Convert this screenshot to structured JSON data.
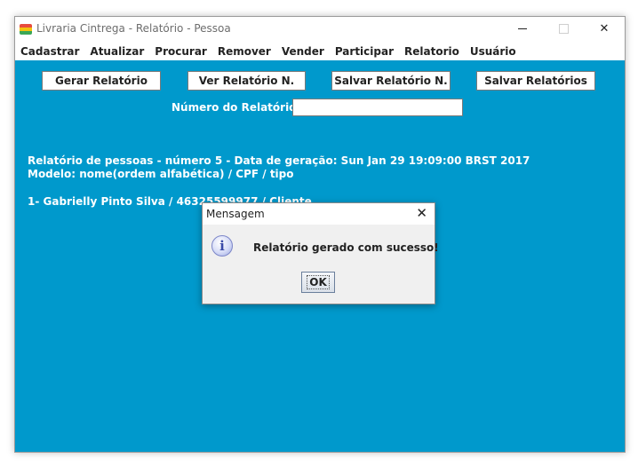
{
  "window": {
    "title": "Livraria Cintrega - Relatório - Pessoa",
    "controls": {
      "minimize": "minimize-icon",
      "maximize": "maximize-icon",
      "close": "close-icon"
    }
  },
  "menu": [
    "Cadastrar",
    "Atualizar",
    "Procurar",
    "Remover",
    "Vender",
    "Participar",
    "Relatorio",
    "Usuário"
  ],
  "toolbar": {
    "gerar": "Gerar Relatório",
    "ver": "Ver Relatório N.",
    "salvar_n": "Salvar Relatório N.",
    "salvar_todos": "Salvar Relatórios"
  },
  "report_number": {
    "label": "Número do Relatório:",
    "value": ""
  },
  "report": {
    "header": "Relatório de pessoas - número 5 - Data de geração: Sun Jan 29 19:09:00 BRST 2017",
    "model": "Modelo: nome(ordem alfabética) / CPF / tipo",
    "entries": [
      "1- Gabrielly Pinto Silva / 46325599977 / Cliente"
    ]
  },
  "dialog": {
    "title": "Mensagem",
    "message": "Relatório gerado com sucesso!",
    "ok": "OK",
    "icon": "info-icon"
  },
  "colors": {
    "content_bg": "#0099cc",
    "dialog_bg": "#f0f0f0"
  }
}
